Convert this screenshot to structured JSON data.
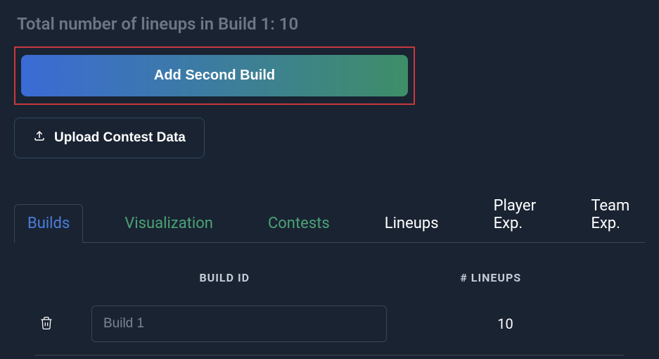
{
  "header": {
    "total_lineups_text": "Total number of lineups in Build 1: 10"
  },
  "buttons": {
    "add_second_build": "Add Second Build",
    "upload_contest_data": "Upload Contest Data"
  },
  "tabs": {
    "builds": "Builds",
    "visualization": "Visualization",
    "contests": "Contests",
    "lineups": "Lineups",
    "player_exp": "Player Exp.",
    "team_exp": "Team Exp."
  },
  "table": {
    "headers": {
      "build_id": "BUILD ID",
      "lineups": "# LINEUPS"
    },
    "rows": [
      {
        "build_id": "Build 1",
        "lineups": "10"
      }
    ]
  }
}
